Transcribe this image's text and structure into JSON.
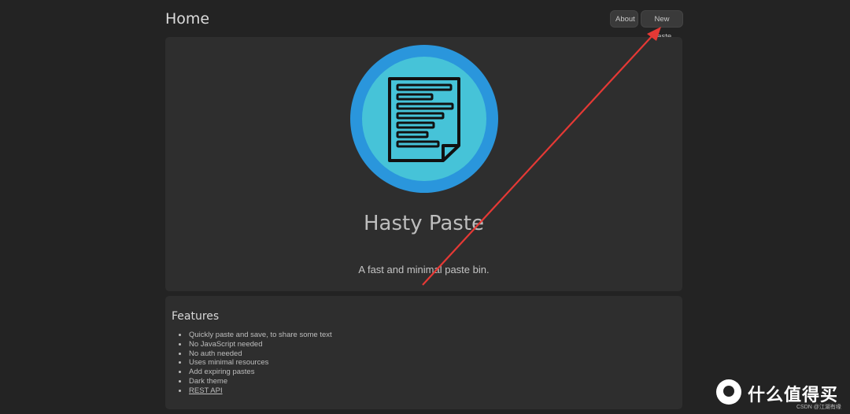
{
  "header": {
    "title": "Home",
    "about_label": "About",
    "new_paste_label": "New Paste"
  },
  "hero": {
    "title": "Hasty Paste",
    "subtitle": "A fast and minimal paste bin."
  },
  "features": {
    "title": "Features",
    "items": [
      "Quickly paste and save, to share some text",
      "No JavaScript needed",
      "No auth needed",
      "Uses minimal resources",
      "Add expiring pastes",
      "Dark theme"
    ],
    "link_label": "REST API"
  },
  "watermark": {
    "brand": "什么值得买",
    "credit": "CSDN @江湖有缘"
  },
  "icons": {
    "logo": "document-icon",
    "annotation": "red-arrow-icon"
  },
  "colors": {
    "background": "#232323",
    "card": "#2e2e2e",
    "logo_outer": "#2a96dc",
    "logo_inner": "#46c3d8",
    "arrow": "#e53935"
  }
}
